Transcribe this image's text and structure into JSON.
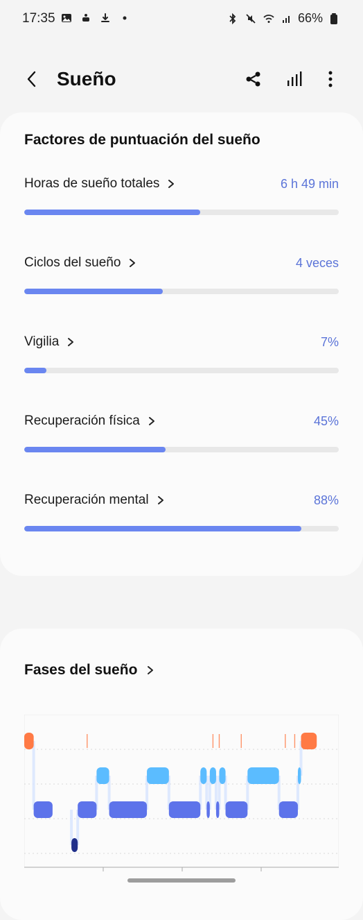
{
  "status_bar": {
    "time": "17:35",
    "battery": "66%",
    "left_icons": [
      "photo-icon",
      "robot-icon",
      "download-icon",
      "dot-icon"
    ],
    "right_icons": [
      "bluetooth-icon",
      "mute-icon",
      "wifi-icon",
      "signal-icon",
      "battery-icon"
    ]
  },
  "header": {
    "title": "Sueño",
    "actions": [
      "share-icon",
      "stats-icon",
      "more-icon"
    ]
  },
  "score_card": {
    "title": "Factores de puntuación del sueño",
    "factors": [
      {
        "label": "Horas de sueño totales",
        "value": "6 h 49 min",
        "progress": 0.56
      },
      {
        "label": "Ciclos del sueño",
        "value": "4 veces",
        "progress": 0.44
      },
      {
        "label": "Vigilia",
        "value": "7%",
        "progress": 0.07
      },
      {
        "label": "Recuperación física",
        "value": "45%",
        "progress": 0.45
      },
      {
        "label": "Recuperación mental",
        "value": "88%",
        "progress": 0.88
      }
    ]
  },
  "phases_card": {
    "title": "Fases del sueño"
  },
  "colors": {
    "accent": "#6a86f0",
    "value_text": "#5b74d8",
    "awake": "#ff7a45",
    "rem": "#5bbcff",
    "light": "#5d73ea",
    "deep": "#1f2f8a"
  },
  "chart_data": {
    "type": "step",
    "stages": [
      "awake",
      "rem",
      "light",
      "deep"
    ],
    "segments": [
      {
        "stage": "awake",
        "start": 0.0,
        "end": 0.03
      },
      {
        "stage": "light",
        "start": 0.03,
        "end": 0.09
      },
      {
        "stage": "deep",
        "start": 0.15,
        "end": 0.17
      },
      {
        "stage": "light",
        "start": 0.17,
        "end": 0.23
      },
      {
        "stage": "rem",
        "start": 0.23,
        "end": 0.27
      },
      {
        "stage": "light",
        "start": 0.27,
        "end": 0.39
      },
      {
        "stage": "rem",
        "start": 0.39,
        "end": 0.46
      },
      {
        "stage": "light",
        "start": 0.46,
        "end": 0.56
      },
      {
        "stage": "rem",
        "start": 0.56,
        "end": 0.58
      },
      {
        "stage": "light",
        "start": 0.58,
        "end": 0.59
      },
      {
        "stage": "rem",
        "start": 0.59,
        "end": 0.61
      },
      {
        "stage": "light",
        "start": 0.61,
        "end": 0.62
      },
      {
        "stage": "rem",
        "start": 0.62,
        "end": 0.64
      },
      {
        "stage": "light",
        "start": 0.64,
        "end": 0.71
      },
      {
        "stage": "rem",
        "start": 0.71,
        "end": 0.81
      },
      {
        "stage": "light",
        "start": 0.81,
        "end": 0.87
      },
      {
        "stage": "rem",
        "start": 0.87,
        "end": 0.88
      },
      {
        "stage": "awake",
        "start": 0.88,
        "end": 0.93
      }
    ],
    "awake_ticks": [
      0.2,
      0.6,
      0.62,
      0.69,
      0.83,
      0.86
    ]
  }
}
